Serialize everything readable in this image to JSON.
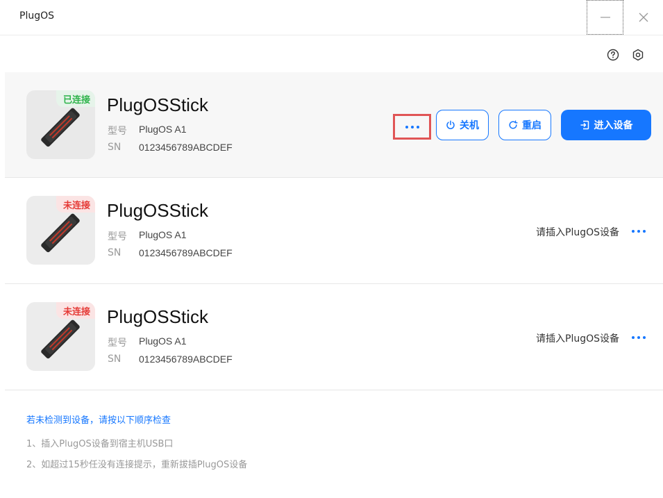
{
  "window": {
    "title": "PlugOS"
  },
  "devices": [
    {
      "status": "已连接",
      "name": "PlugOSStick",
      "model_label": "型号",
      "model": "PlugOS A1",
      "sn_label": "SN",
      "sn": "0123456789ABCDEF",
      "actions": {
        "power_label": "关机",
        "restart_label": "重启",
        "enter_label": "进入设备"
      }
    },
    {
      "status": "未连接",
      "name": "PlugOSStick",
      "model_label": "型号",
      "model": "PlugOS A1",
      "sn_label": "SN",
      "sn": "0123456789ABCDEF",
      "hint": "请插入PlugOS设备"
    },
    {
      "status": "未连接",
      "name": "PlugOSStick",
      "model_label": "型号",
      "model": "PlugOS A1",
      "sn_label": "SN",
      "sn": "0123456789ABCDEF",
      "hint": "请插入PlugOS设备"
    }
  ],
  "tips": {
    "title": "若未检测到设备，请按以下顺序检查",
    "items": [
      "1、插入PlugOS设备到宿主机USB口",
      "2、如超过15秒任没有连接提示，重新拔插PlugOS设备"
    ]
  },
  "icons": {
    "minimize": "minimize-icon",
    "close": "close-icon",
    "help": "help-icon",
    "settings": "settings-icon",
    "more": "more-dots-icon",
    "power": "power-icon",
    "restart": "restart-icon",
    "enter": "enter-icon"
  },
  "colors": {
    "accent": "#1677ff",
    "connected": "#2db34a",
    "disconnected": "#e53935",
    "highlight_border": "#e05556"
  }
}
